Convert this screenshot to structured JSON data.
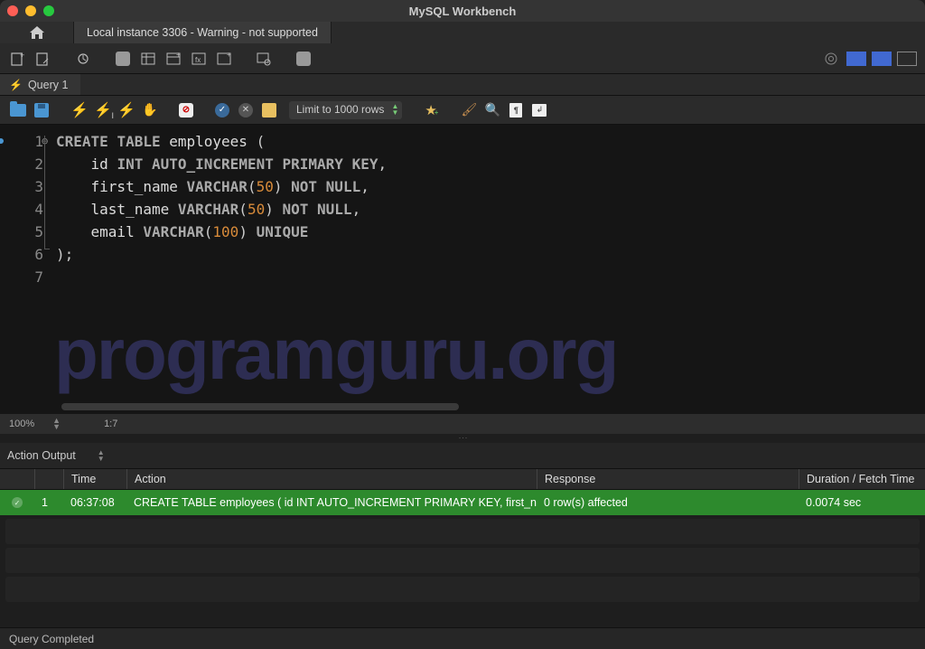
{
  "titlebar": {
    "title": "MySQL Workbench"
  },
  "conn": {
    "home": "⌂",
    "tab": "Local instance 3306 - Warning - not supported"
  },
  "qtab": {
    "label": "Query 1"
  },
  "limit": {
    "value": "Limit to 1000 rows"
  },
  "code": {
    "lines": [
      {
        "n": "1",
        "seg": [
          {
            "t": "CREATE",
            "c": "kw"
          },
          {
            "t": " ",
            "c": ""
          },
          {
            "t": "TABLE",
            "c": "kw"
          },
          {
            "t": " employees ",
            "c": "ident"
          },
          {
            "t": "(",
            "c": "punct"
          }
        ]
      },
      {
        "n": "2",
        "seg": [
          {
            "t": "    id ",
            "c": "ident"
          },
          {
            "t": "INT",
            "c": "type"
          },
          {
            "t": " ",
            "c": ""
          },
          {
            "t": "AUTO_INCREMENT",
            "c": "type"
          },
          {
            "t": " ",
            "c": ""
          },
          {
            "t": "PRIMARY",
            "c": "type"
          },
          {
            "t": " ",
            "c": ""
          },
          {
            "t": "KEY",
            "c": "type"
          },
          {
            "t": ",",
            "c": "punct"
          }
        ]
      },
      {
        "n": "3",
        "seg": [
          {
            "t": "    first_name ",
            "c": "ident"
          },
          {
            "t": "VARCHAR",
            "c": "type"
          },
          {
            "t": "(",
            "c": "punct"
          },
          {
            "t": "50",
            "c": "num"
          },
          {
            "t": ")",
            "c": "punct"
          },
          {
            "t": " ",
            "c": ""
          },
          {
            "t": "NOT",
            "c": "type"
          },
          {
            "t": " ",
            "c": ""
          },
          {
            "t": "NULL",
            "c": "type"
          },
          {
            "t": ",",
            "c": "punct"
          }
        ]
      },
      {
        "n": "4",
        "seg": [
          {
            "t": "    last_name ",
            "c": "ident"
          },
          {
            "t": "VARCHAR",
            "c": "type"
          },
          {
            "t": "(",
            "c": "punct"
          },
          {
            "t": "50",
            "c": "num"
          },
          {
            "t": ")",
            "c": "punct"
          },
          {
            "t": " ",
            "c": ""
          },
          {
            "t": "NOT",
            "c": "type"
          },
          {
            "t": " ",
            "c": ""
          },
          {
            "t": "NULL",
            "c": "type"
          },
          {
            "t": ",",
            "c": "punct"
          }
        ]
      },
      {
        "n": "5",
        "seg": [
          {
            "t": "    email ",
            "c": "ident"
          },
          {
            "t": "VARCHAR",
            "c": "type"
          },
          {
            "t": "(",
            "c": "punct"
          },
          {
            "t": "100",
            "c": "num"
          },
          {
            "t": ")",
            "c": "punct"
          },
          {
            "t": " ",
            "c": ""
          },
          {
            "t": "UNIQUE",
            "c": "type"
          }
        ]
      },
      {
        "n": "6",
        "seg": [
          {
            "t": ");",
            "c": "punct"
          }
        ]
      },
      {
        "n": "7",
        "seg": []
      }
    ]
  },
  "ed_status": {
    "zoom": "100%",
    "pos": "1:7"
  },
  "watermark": "programguru.org",
  "output": {
    "label": "Action Output",
    "cols": {
      "time": "Time",
      "action": "Action",
      "response": "Response",
      "dur": "Duration / Fetch Time"
    },
    "rows": [
      {
        "idx": "1",
        "time": "06:37:08",
        "action": "CREATE TABLE employees (     id INT AUTO_INCREMENT PRIMARY KEY,     first_n…",
        "response": "0 row(s) affected",
        "dur": "0.0074 sec",
        "status": "success"
      }
    ]
  },
  "footer": {
    "status": "Query Completed"
  }
}
